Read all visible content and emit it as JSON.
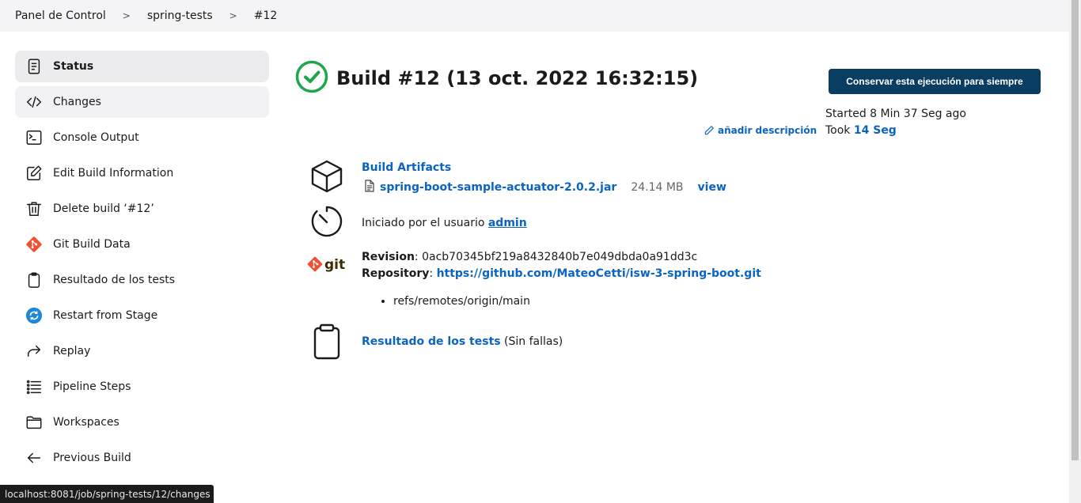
{
  "breadcrumb": {
    "items": [
      "Panel de Control",
      "spring-tests",
      "#12"
    ],
    "separator": ">"
  },
  "sidebar": {
    "items": [
      {
        "label": "Status",
        "icon": "document-icon"
      },
      {
        "label": "Changes",
        "icon": "code-icon"
      },
      {
        "label": "Console Output",
        "icon": "terminal-icon"
      },
      {
        "label": "Edit Build Information",
        "icon": "edit-icon"
      },
      {
        "label": "Delete build ‘#12’",
        "icon": "trash-icon"
      },
      {
        "label": "Git Build Data",
        "icon": "git-icon"
      },
      {
        "label": "Resultado de los tests",
        "icon": "clipboard-icon"
      },
      {
        "label": "Restart from Stage",
        "icon": "restart-icon"
      },
      {
        "label": "Replay",
        "icon": "replay-icon"
      },
      {
        "label": "Pipeline Steps",
        "icon": "list-icon"
      },
      {
        "label": "Workspaces",
        "icon": "folder-icon"
      },
      {
        "label": "Previous Build",
        "icon": "arrow-left-icon"
      }
    ]
  },
  "build": {
    "title": "Build #12 (13 oct. 2022 16:32:15)",
    "keep_button": "Conservar esta ejecución para siempre",
    "started": "Started 8 Min 37 Seg ago",
    "took_prefix": "Took ",
    "took_value": "14 Seg",
    "add_description": "añadir descripción"
  },
  "artifacts": {
    "title": "Build Artifacts",
    "file_name": "spring-boot-sample-actuator-2.0.2.jar",
    "file_size": "24.14 MB",
    "view_label": "view"
  },
  "cause": {
    "prefix": "Iniciado por el usuario ",
    "user": "admin"
  },
  "git": {
    "logo_text": "git",
    "revision_label": "Revision",
    "revision_value": "0acb70345bf219a8432840b7e049dbda0a91dd3c",
    "repository_label": "Repository",
    "repository_url": "https://github.com/MateoCetti/isw-3-spring-boot.git",
    "branches": [
      "refs/remotes/origin/main"
    ]
  },
  "tests": {
    "link": "Resultado de los tests",
    "suffix": " (Sin fallas)"
  },
  "statusbar": {
    "url": "localhost:8081/job/spring-tests/12/changes"
  },
  "colors": {
    "success": "#1ea64b",
    "link": "#0b63c4",
    "button": "#0a3d62",
    "git_orange": "#f05133"
  }
}
